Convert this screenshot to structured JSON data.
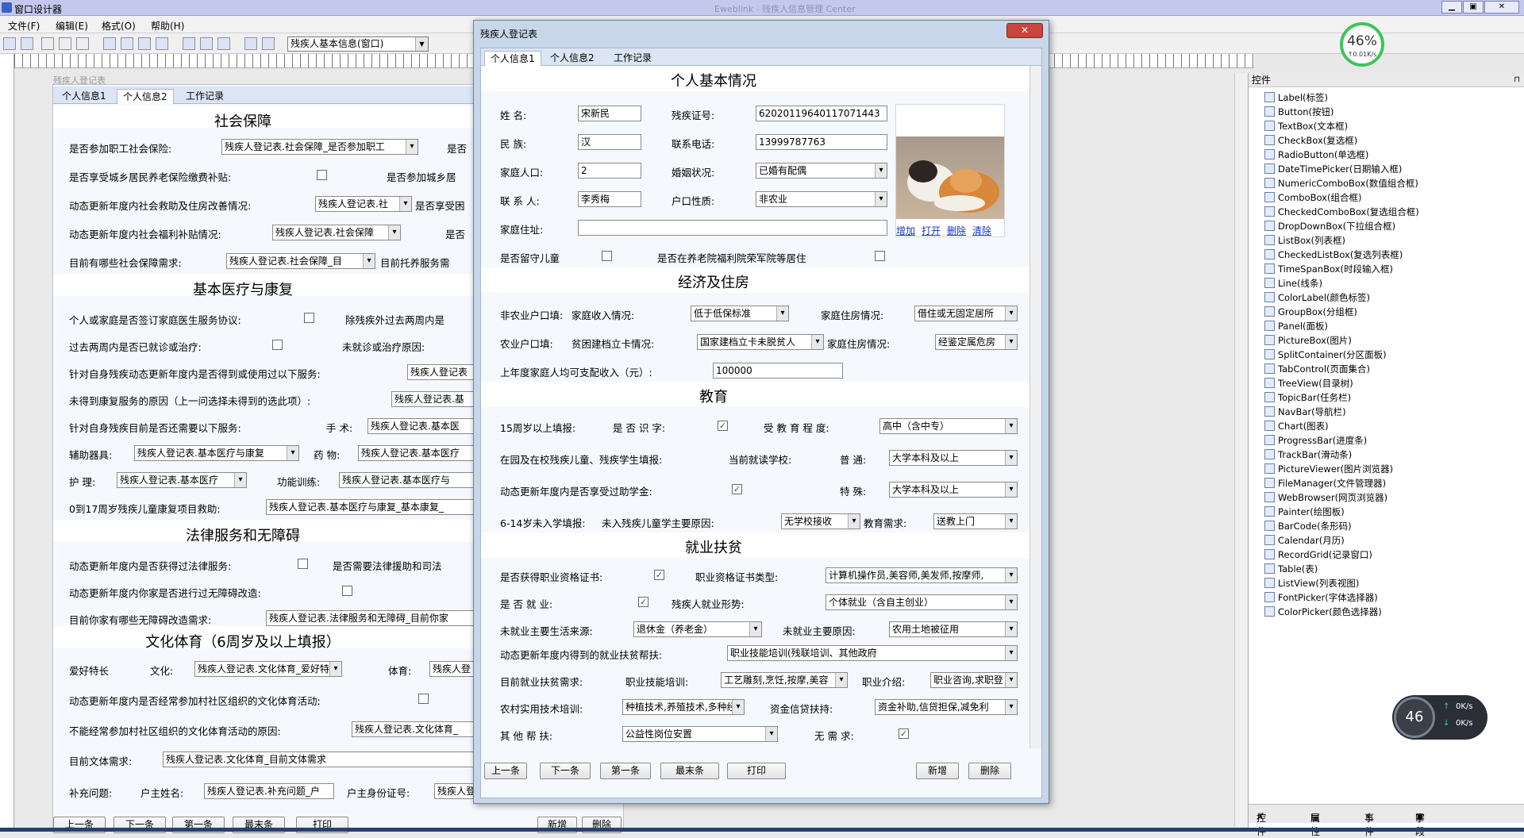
{
  "app": {
    "title": "窗口设计器",
    "titlebar_center": "Eweblink - 残疾人信息管理 Center"
  },
  "menu": [
    "文件(F)",
    "编辑(E)",
    "格式(O)",
    "帮助(H)"
  ],
  "toolbar": {
    "form_select": "残疾人基本信息(窗口)"
  },
  "designer": {
    "form_caption": "残疾人登记表",
    "tabs": [
      "个人信息1",
      "个人信息2",
      "工作记录"
    ],
    "sections": {
      "s1": "社会保障",
      "s2": "基本医疗与康复",
      "s3": "法律服务和无障碍",
      "s4": "文化体育（6周岁及以上填报）"
    },
    "rows": [
      {
        "l": "是否参加职工社会保险:",
        "v": "残疾人登记表.社会保障_是否参加职工",
        "r": "是否"
      },
      {
        "l": "是否享受城乡居民养老保险缴费补贴:",
        "r": "是否参加城乡居"
      },
      {
        "l": "动态更新年度内社会救助及住房改善情况:",
        "v": "残疾人登记表.社",
        "r": "是否享受困"
      },
      {
        "l": "动态更新年度内社会福利补贴情况:",
        "v": "残疾人登记表.社会保障",
        "r": "是否"
      },
      {
        "l": "目前有哪些社会保障需求:",
        "v": "残疾人登记表.社会保障_目",
        "r": "目前托养服务需"
      },
      {
        "l": "个人或家庭是否签订家庭医生服务协议:",
        "r": "除残疾外过去两周内是"
      },
      {
        "l": "过去两周内是否已就诊或治疗:",
        "r": "未就诊或治疗原因:"
      },
      {
        "l": "针对自身残疾动态更新年度内是否得到或使用过以下服务:",
        "v": "残疾人登记表"
      },
      {
        "l": "未得到康复服务的原因（上一问选择未得到的选此项）:",
        "v": "残疾人登记表.基"
      },
      {
        "l": "针对自身残疾目前是否还需要以下服务:",
        "r": "手  术:",
        "v": "残疾人登记表.基本医"
      },
      {
        "l": "辅助器具:",
        "v": "残疾人登记表.基本医疗与康复",
        "r": "药  物:",
        "v2": "残疾人登记表.基本医疗"
      },
      {
        "l": "护  理:",
        "v": "残疾人登记表.基本医疗",
        "r": "功能训练:",
        "v2": "残疾人登记表.基本医疗与"
      },
      {
        "l": "0到17周岁残疾儿童康复项目救助:",
        "v": "残疾人登记表.基本医疗与康复_基本康复_"
      },
      {
        "l": "动态更新年度内是否获得过法律服务:",
        "r": "是否需要法律援助和司法"
      },
      {
        "l": "动态更新年度内你家是否进行过无障碍改造:"
      },
      {
        "l": "目前你家有哪些无障碍改造需求:",
        "v": "残疾人登记表.法律服务和无障碍_目前你家"
      },
      {
        "l": "爱好特长",
        "r": "文化:",
        "v": "残疾人登记表.文化体育_爱好特长",
        "r2": "体育:",
        "v2": "残疾人登"
      },
      {
        "l": "动态更新年度内是否经常参加村社区组织的文化体育活动:"
      },
      {
        "l": "不能经常参加村社区组织的文化体育活动的原因:",
        "v": "残疾人登记表.文化体育_"
      },
      {
        "l": "目前文体需求:",
        "v": "残疾人登记表.文化体育_目前文体需求"
      },
      {
        "l": "补充问题:",
        "r": "户主姓名:",
        "v": "残疾人登记表.补充问题_户",
        "r2": "户主身份证号:",
        "v2": "残疾人登记"
      }
    ],
    "buttons": [
      "上一条",
      "下一条",
      "第一条",
      "最末条",
      "打印",
      "新增",
      "删除"
    ]
  },
  "dialog": {
    "title": "残疾人登记表",
    "tabs": [
      "个人信息1",
      "个人信息2",
      "工作记录"
    ],
    "sec1": "个人基本情况",
    "name_l": "姓    名:",
    "name": "宋新民",
    "cert_l": "残疾证号:",
    "cert": "62020119640117071443",
    "eth_l": "民    族:",
    "eth": "汉",
    "phone_l": "联系电话:",
    "phone": "13999787763",
    "pop_l": "家庭人口:",
    "pop": "2",
    "mar_l": "婚姻状况:",
    "mar": "已婚有配偶",
    "contact_l": "联 系 人:",
    "contact": "李秀梅",
    "hukou_l": "户口性质:",
    "hukou": "非农业",
    "addr_l": "家庭住址:",
    "addr": "",
    "left_l": "是否留守儿童",
    "nurse_l": "是否在养老院福利院荣军院等居住",
    "photo_links": [
      "增加",
      "打开",
      "删除",
      "清除"
    ],
    "sec2": "经济及住房",
    "nonag_l": "非农业户口填:",
    "inc_l": "家庭收入情况:",
    "inc": "低于低保标准",
    "house_l": "家庭住房情况:",
    "house": "借住或无固定居所",
    "ag_l": "农业户口填:",
    "poor_l": "贫困建档立卡情况:",
    "poor": "国家建档立卡未脱贫人",
    "house2_l": "家庭住房情况:",
    "house2": "经鉴定属危房",
    "income_l": "上年度家庭人均可支配收入（元）:",
    "income": "100000",
    "sec3": "教育",
    "e15_l": "15周岁以上填报:",
    "lit_l": "是 否 识 字:",
    "edu_l": "受 教 育 程 度:",
    "edu": "高中（含中专）",
    "school_l": "在园及在校残疾儿童、残疾学生填报:",
    "cur_l": "当前就读学校:",
    "normal_l": "普  通:",
    "normal": "大学本科及以上",
    "aid_l": "动态更新年度内是否享受过助学金:",
    "spec_l": "特  殊:",
    "spec": "大学本科及以上",
    "e614_l": "6-14岁未入学填报:",
    "nos_l": "未入残疾儿童学主要原因:",
    "nos": "无学校接收",
    "need_l": "教育需求:",
    "need": "送教上门",
    "sec4": "就业扶贫",
    "qual_l": "是否获得职业资格证书:",
    "qtype_l": "职业资格证书类型:",
    "qtype": "计算机操作员,美容师,美发师,按摩师,",
    "emp_l": "是 否 就 业:",
    "form_l": "残疾人就业形势:",
    "form": "个体就业（含自主创业）",
    "src_l": "未就业主要生活来源:",
    "src": "退休金（养老金）",
    "reason_l": "未就业主要原因:",
    "reason": "农用土地被征用",
    "help_l": "动态更新年度内得到的就业扶贫帮扶:",
    "help": "职业技能培训(残联培训、其他政府",
    "cur2_l": "目前就业扶贫需求:",
    "train_l": "职业技能培训:",
    "train": "工艺雕刻,烹饪,按摩,美容",
    "intro_l": "职业介绍:",
    "intro": "职业咨询,求职登",
    "rural_l": "农村实用技术培训:",
    "rural": "种植技术,养殖技术,多种经营",
    "loan_l": "资金信贷扶持:",
    "loan": "资金补助,信贷担保,减免利",
    "other_l": "其  他  帮  扶:",
    "other": "公益性岗位安置",
    "noneed_l": "无  需  求:",
    "buttons": [
      "上一条",
      "下一条",
      "第一条",
      "最末条",
      "打印",
      "新增",
      "删除"
    ]
  },
  "panel": {
    "title": "控件",
    "items": [
      "Label(标签)",
      "Button(按钮)",
      "TextBox(文本框)",
      "CheckBox(复选框)",
      "RadioButton(单选框)",
      "DateTimePicker(日期输入框)",
      "NumericComboBox(数值组合框)",
      "ComboBox(组合框)",
      "CheckedComboBox(复选组合框)",
      "DropDownBox(下拉组合框)",
      "ListBox(列表框)",
      "CheckedListBox(复选列表框)",
      "TimeSpanBox(时段输入框)",
      "Line(线条)",
      "ColorLabel(颜色标签)",
      "GroupBox(分组框)",
      "Panel(面板)",
      "PictureBox(图片)",
      "SplitContainer(分区面板)",
      "TabControl(页面集合)",
      "TreeView(目录树)",
      "TopicBar(任务栏)",
      "NavBar(导航栏)",
      "Chart(图表)",
      "ProgressBar(进度条)",
      "TrackBar(滑动条)",
      "PictureViewer(图片浏览器)",
      "FileManager(文件管理器)",
      "WebBrowser(网页浏览器)",
      "Painter(绘图板)",
      "BarCode(条形码)",
      "Calendar(月历)",
      "RecordGrid(记录窗口)",
      "Table(表)",
      "ListView(列表视图)",
      "FontPicker(字体选择器)",
      "ColorPicker(颜色选择器)"
    ],
    "tabs": [
      "控件",
      "属性",
      "事件",
      "字段"
    ]
  },
  "gauge": {
    "pct": "46%",
    "speed": "↑0.01K/s",
    "pct2": "46",
    "up": "0K/s",
    "down": "0K/s"
  }
}
